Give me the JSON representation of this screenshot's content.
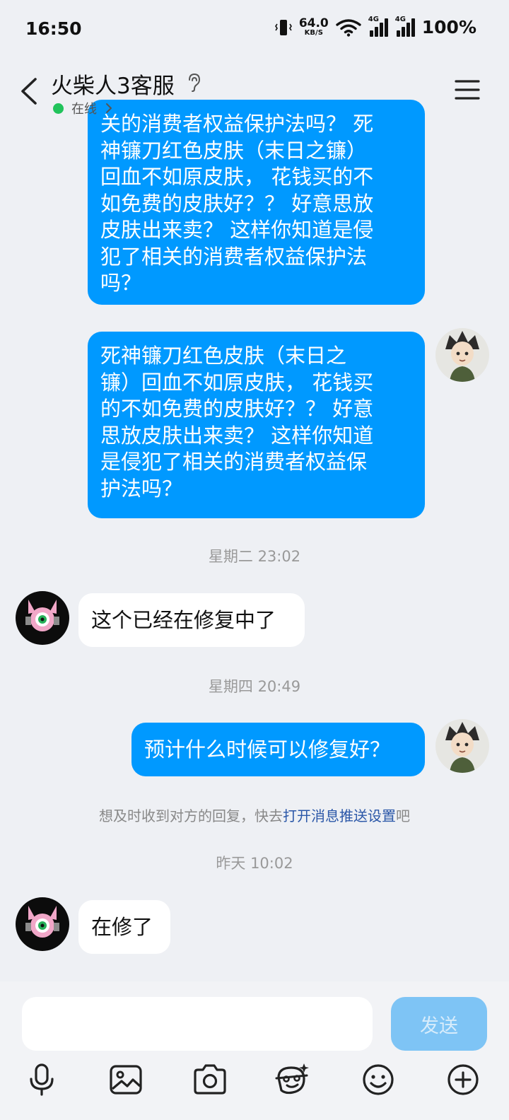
{
  "status_bar": {
    "time": "16:50",
    "net_speed_value": "64.0",
    "net_speed_unit": "KB/S",
    "sim_tag_1": "4G",
    "sim_tag_2": "4G",
    "battery": "100%"
  },
  "header": {
    "title": "火柴人3客服",
    "status": "在线",
    "status_color": "#21c35b"
  },
  "messages": [
    {
      "type": "out",
      "lines": [
        "关的消费者权益保护法吗？ 死",
        "神镰刀红色皮肤（末日之镰）",
        "回血不如原皮肤， 花钱买的不",
        "如免费的皮肤好？？ 好意思放",
        "皮肤出来卖？ 这样你知道是侵",
        "犯了相关的消费者权益保护法",
        "吗？"
      ]
    },
    {
      "type": "out",
      "lines": [
        "死神镰刀红色皮肤（末日之",
        "镰）回血不如原皮肤， 花钱买",
        "的不如免费的皮肤好？？ 好意",
        "思放皮肤出来卖？ 这样你知道",
        "是侵犯了相关的消费者权益保",
        "护法吗？"
      ]
    },
    {
      "type": "time",
      "text": "星期二 23:02"
    },
    {
      "type": "in",
      "text": "这个已经在修复中了"
    },
    {
      "type": "time",
      "text": "星期四 20:49"
    },
    {
      "type": "out",
      "text": "预计什么时候可以修复好？"
    },
    {
      "type": "time",
      "text": "昨天 10:02"
    },
    {
      "type": "in",
      "text": "在修了"
    }
  ],
  "notice": {
    "prefix": "想及时收到对方的回复，快去",
    "link": "打开消息推送设置",
    "suffix": "吧"
  },
  "input": {
    "placeholder": "",
    "send_label": "发送"
  },
  "toolbar_icons": [
    "microphone-icon",
    "image-icon",
    "camera-icon",
    "sticker-face-icon",
    "emoji-icon",
    "plus-icon"
  ],
  "colors": {
    "outgoing_bubble": "#0099ff",
    "incoming_bubble": "#ffffff",
    "background": "#eef0f4",
    "send_button": "#7ec4f5"
  }
}
